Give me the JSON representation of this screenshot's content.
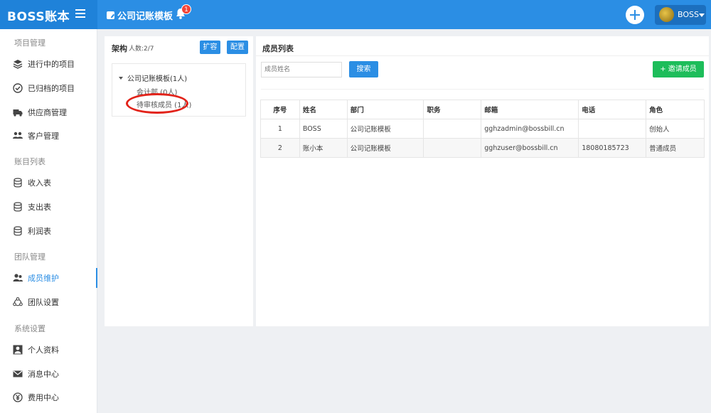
{
  "header": {
    "brand": "BOSS账本",
    "template_name": "公司记账模板",
    "notification_count": "1",
    "user_name": "BOSS"
  },
  "sidebar": {
    "sections": [
      {
        "title": "项目管理",
        "items": [
          {
            "label": "进行中的项目",
            "icon": "layers-icon"
          },
          {
            "label": "已归档的项目",
            "icon": "check-circle-icon"
          },
          {
            "label": "供应商管理",
            "icon": "truck-icon"
          },
          {
            "label": "客户管理",
            "icon": "users-icon"
          }
        ]
      },
      {
        "title": "账目列表",
        "items": [
          {
            "label": "收入表",
            "icon": "database-icon"
          },
          {
            "label": "支出表",
            "icon": "database-icon"
          },
          {
            "label": "利润表",
            "icon": "database-icon"
          }
        ]
      },
      {
        "title": "团队管理",
        "items": [
          {
            "label": "成员维护",
            "icon": "user-group-icon",
            "active": true
          },
          {
            "label": "团队设置",
            "icon": "team-settings-icon"
          }
        ]
      },
      {
        "title": "系统设置",
        "items": [
          {
            "label": "个人资料",
            "icon": "profile-icon"
          },
          {
            "label": "消息中心",
            "icon": "envelope-icon"
          },
          {
            "label": "费用中心",
            "icon": "fee-icon"
          }
        ]
      }
    ]
  },
  "org_panel": {
    "title": "架构",
    "count": "人数:2/7",
    "expand_label": "扩容",
    "config_label": "配置",
    "tree": {
      "root": "公司记账模板(1人)",
      "children": [
        "会计部 (0人)",
        "待审核成员 (1人)"
      ]
    }
  },
  "member_panel": {
    "title": "成员列表",
    "search_placeholder": "成员姓名",
    "search_label": "搜索",
    "invite_label": "+ 邀请成员",
    "columns": [
      "序号",
      "姓名",
      "部门",
      "职务",
      "邮箱",
      "电话",
      "角色"
    ],
    "rows": [
      [
        "1",
        "BOSS",
        "公司记账模板",
        "",
        "gghzadmin@bossbill.cn",
        "",
        "创始人"
      ],
      [
        "2",
        "账小本",
        "公司记账模板",
        "",
        "gghzuser@bossbill.cn",
        "18080185723",
        "普通成员"
      ]
    ]
  },
  "colors": {
    "primary": "#2b8ee4",
    "success": "#1dbd5a",
    "highlight": "#e2231a"
  }
}
